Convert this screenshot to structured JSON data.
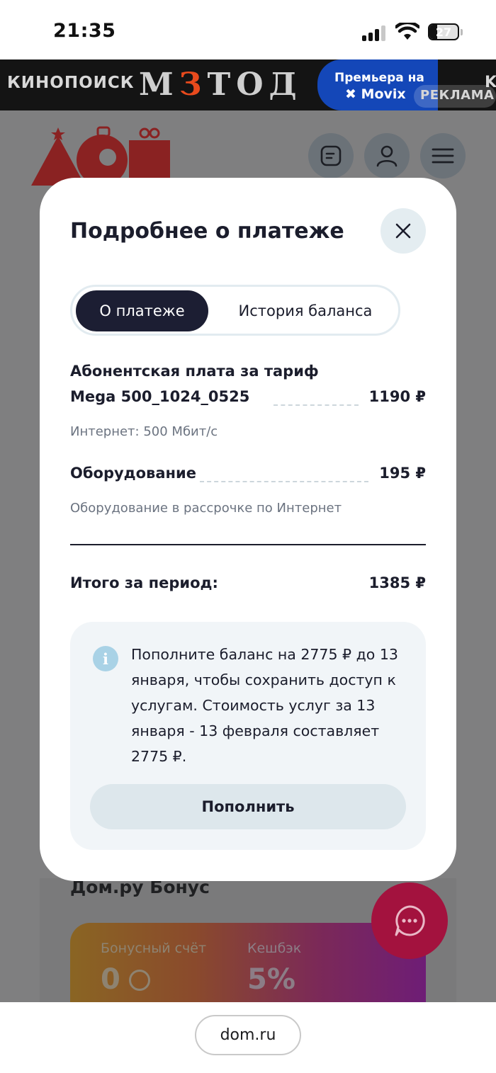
{
  "status_bar": {
    "time": "21:35",
    "battery": "27",
    "battery_level": 0.27
  },
  "ad": {
    "brand": "КИНОПОИСК",
    "title_left": "М",
    "title_accent": "З",
    "title_right": "ТОД",
    "premiere_line1": "Премьера на",
    "premiere_line2": "✖ Movix",
    "tag": "РЕКЛАМА",
    "brand_repeat": "K"
  },
  "header": {
    "buttons": [
      {
        "icon": "document-icon"
      },
      {
        "icon": "user-icon"
      },
      {
        "icon": "menu-icon"
      }
    ]
  },
  "modal": {
    "title": "Подробнее о платеже",
    "tabs": {
      "active": "О платеже",
      "inactive": "История баланса"
    },
    "items": [
      {
        "title_line1": "Абонентская плата за тариф",
        "title_line2": "Mega 500_1024_0525",
        "amount": "1190 ₽",
        "subtitle": "Интернет: 500 Мбит/с"
      },
      {
        "title": "Оборудование",
        "amount": "195 ₽",
        "subtitle": "Оборудование в рассрочке по Интернет"
      }
    ],
    "total": {
      "label": "Итого за период:",
      "amount": "1385 ₽"
    },
    "notice": {
      "icon_letter": "i",
      "text": "Пополните баланс на 2775 ₽ до 13 января, чтобы сохранить доступ к услугам. Стоимость услуг за 13 января - 13 февраля составляет 2775 ₽.",
      "button": "Пополнить"
    }
  },
  "bonus": {
    "title": "Дом.ру Бонус",
    "bonus_label": "Бонусный счёт",
    "bonus_value": "0",
    "cashback_label": "Кешбэк",
    "cashback_value": "5%"
  },
  "browser": {
    "url": "dom.ru"
  },
  "colors": {
    "brand_red": "#d4202a",
    "tab_active": "#1c1e33",
    "overlay": "#7f7f80"
  }
}
